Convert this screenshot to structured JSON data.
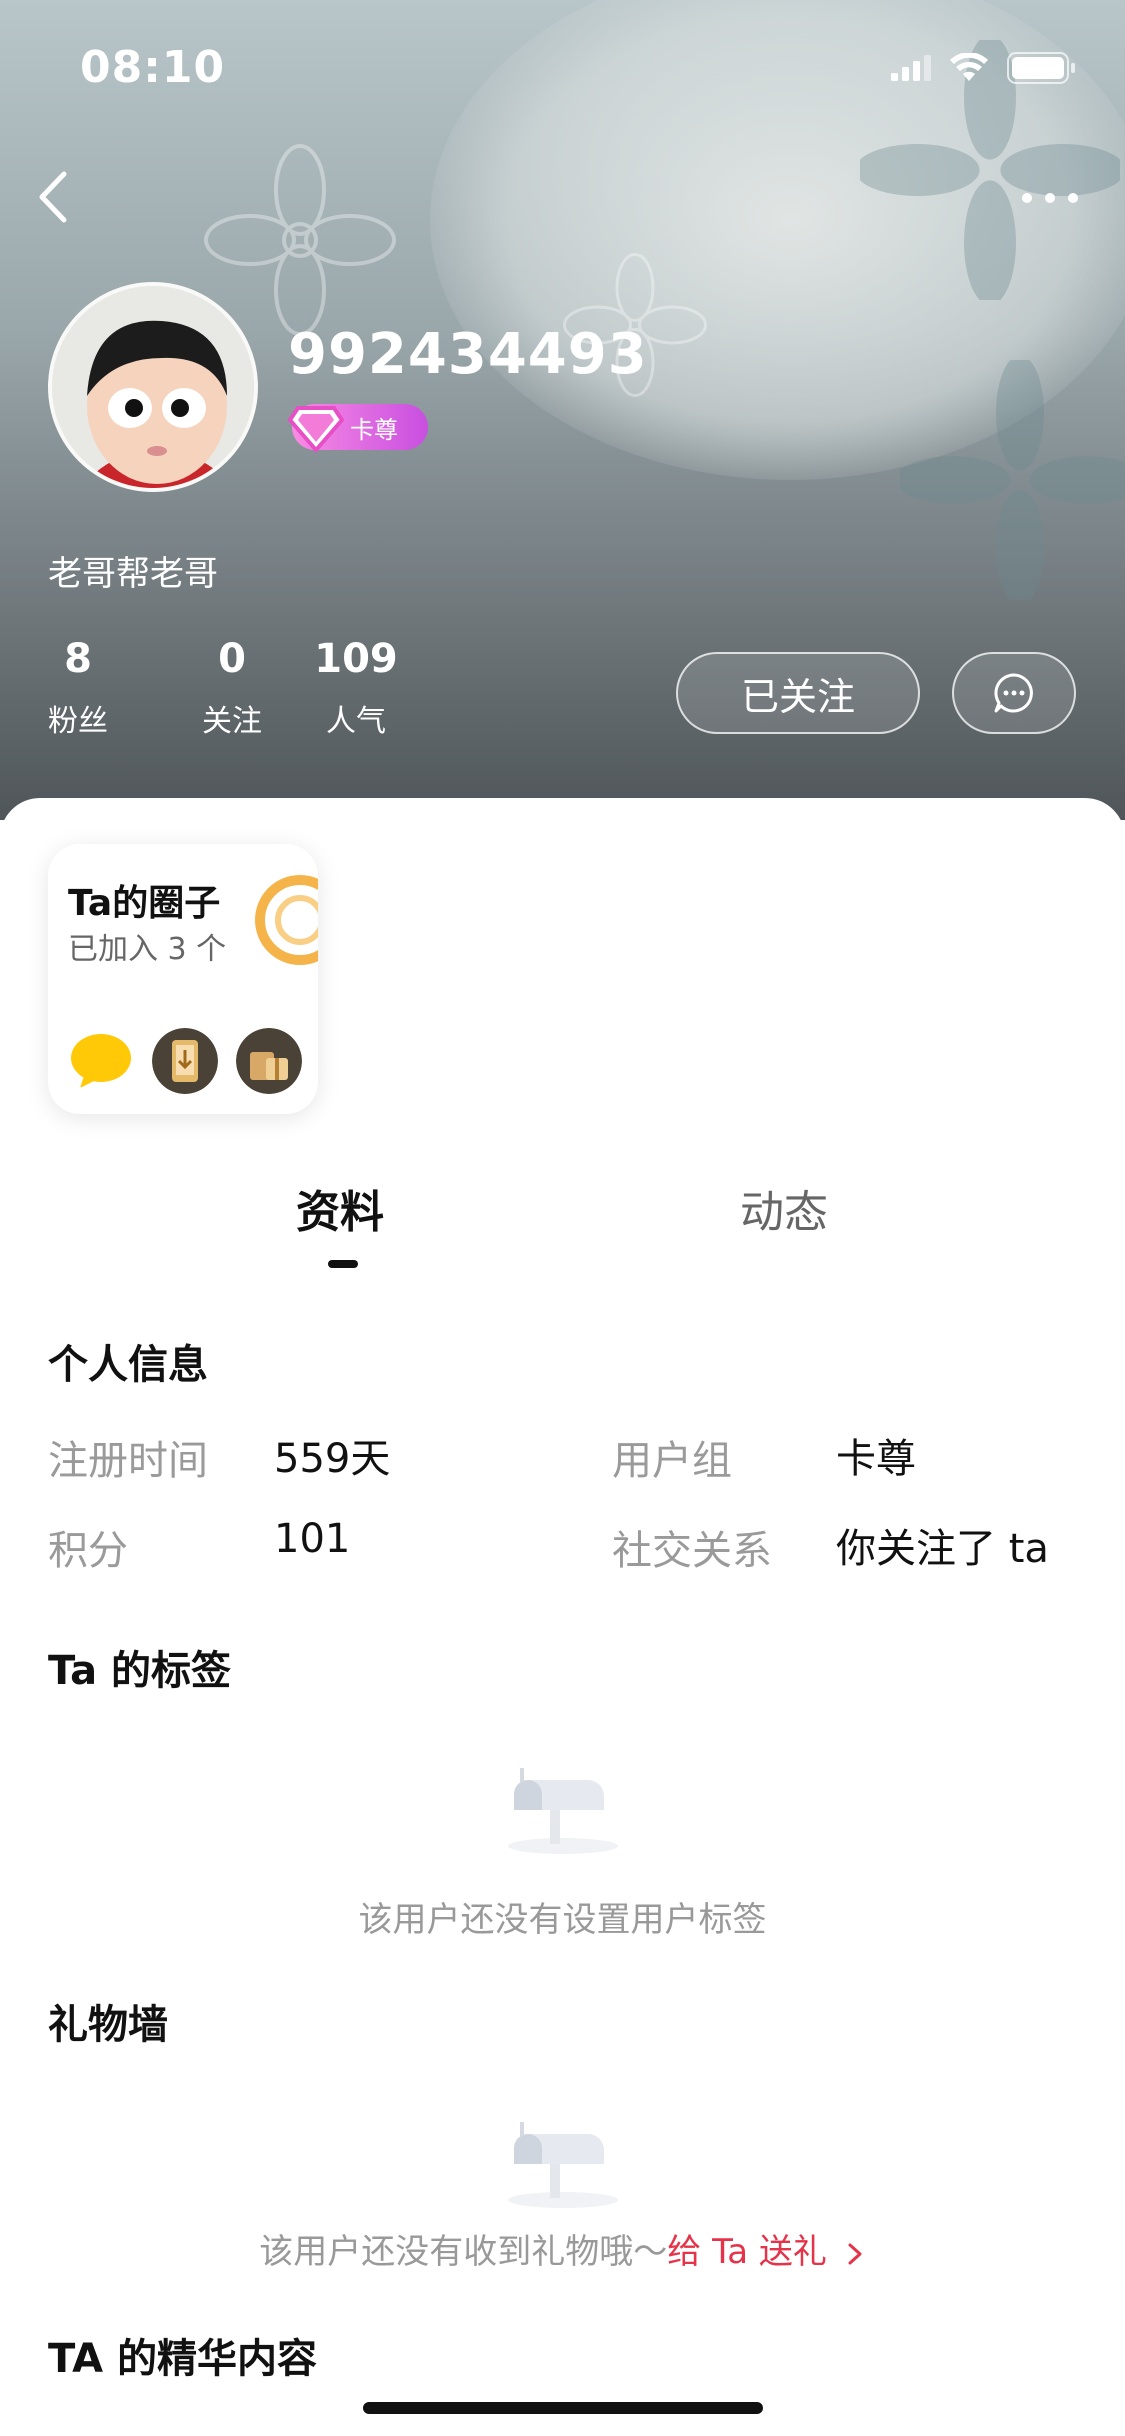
{
  "status_bar": {
    "time": "08:10"
  },
  "profile": {
    "username": "992434493",
    "vip_label": "卡尊",
    "bio": "老哥帮老哥",
    "stats": [
      {
        "value": "8",
        "label": "粉丝"
      },
      {
        "value": "0",
        "label": "关注"
      },
      {
        "value": "109",
        "label": "人气"
      }
    ],
    "follow_button": "已关注"
  },
  "circle": {
    "title": "Ta的圈子",
    "subtitle": "已加入 3 个"
  },
  "tabs": [
    {
      "label": "资料",
      "active": true
    },
    {
      "label": "动态",
      "active": false
    }
  ],
  "personal_info": {
    "title": "个人信息",
    "rows": [
      {
        "label": "注册时间",
        "value": "559天",
        "label2": "用户组",
        "value2": "卡尊"
      },
      {
        "label": "积分",
        "value": "101",
        "label2": "社交关系",
        "value2": "你关注了 ta"
      }
    ]
  },
  "tags_section": {
    "title": "Ta 的标签",
    "empty_text": "该用户还没有设置用户标签"
  },
  "gift_section": {
    "title": "礼物墙",
    "empty_text": "该用户还没有收到礼物哦～",
    "link_text": "给 Ta 送礼"
  },
  "highlights_section": {
    "title": "TA 的精华内容"
  },
  "colors": {
    "accent_red": "#e5334a",
    "vip_pink": "#f98be3"
  }
}
